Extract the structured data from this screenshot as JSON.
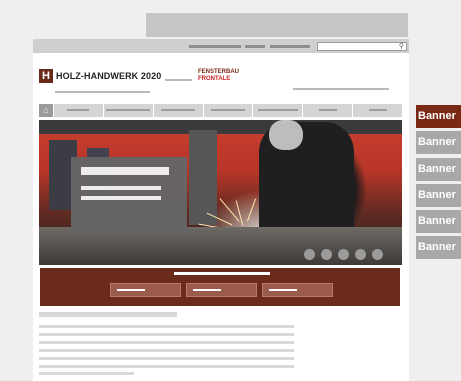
{
  "header": {
    "logo_mark": "H",
    "logo_text": "HOLZ-HANDWERK 2020",
    "partner_line1": "FENSTERBAU",
    "partner_line2": "FRONTALE"
  },
  "search": {
    "icon": "magnifier",
    "glyph": "⚲"
  },
  "nav": {
    "home_icon": "house",
    "home_glyph": "⌂",
    "items_count_hint": "7 placeholder items"
  },
  "banners": [
    {
      "label": "Banner",
      "color": "#7a2a14"
    },
    {
      "label": "Banner",
      "color": "#a8a8a8"
    },
    {
      "label": "Banner",
      "color": "#a8a8a8"
    },
    {
      "label": "Banner",
      "color": "#a8a8a8"
    },
    {
      "label": "Banner",
      "color": "#a8a8a8"
    },
    {
      "label": "Banner",
      "color": "#a8a8a8"
    }
  ],
  "colors": {
    "brand_brown": "#6b2b1b",
    "placeholder_gray": "#c6c6c6",
    "overlay_gray": "#666666"
  }
}
